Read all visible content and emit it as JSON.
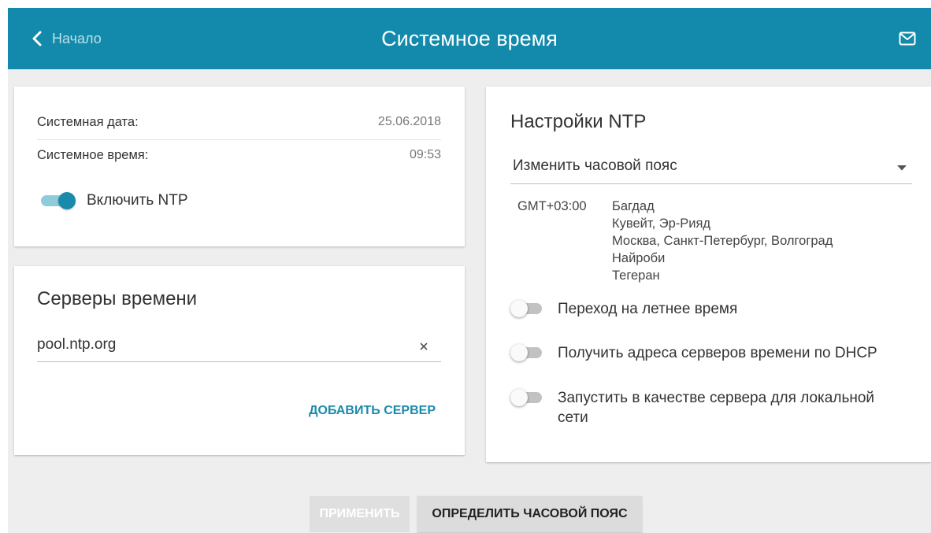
{
  "colors": {
    "header_background": "#138aab",
    "accent": "#1a8aab",
    "toggle_track_on": "#8fcbdb",
    "toggle_track_off": "#c2c2c2",
    "page_background": "#eeeeee"
  },
  "header": {
    "back_icon": "chevron-left-icon",
    "back_label": "Начало",
    "title": "Системное время",
    "mail_icon": "envelope-icon"
  },
  "system_info": {
    "date_label": "Системная дата:",
    "date_value": "25.06.2018",
    "time_label": "Системное время:",
    "time_value": "09:53",
    "ntp_toggle": {
      "label": "Включить NTP",
      "checked": true
    }
  },
  "time_servers": {
    "title": "Серверы времени",
    "servers": [
      {
        "address": "pool.ntp.org",
        "clear_icon": "close-icon"
      }
    ],
    "add_button": "ДОБАВИТЬ СЕРВЕР"
  },
  "ntp_settings": {
    "title": "Настройки NTP",
    "timezone_select": {
      "selected": "Изменить часовой пояс",
      "arrow_icon": "caret-down-icon"
    },
    "timezone": {
      "offset": "GMT+03:00",
      "cities": [
        "Багдад",
        "Кувейт, Эр-Рияд",
        "Москва, Санкт-Петербург, Волгоград",
        "Найроби",
        "Тегеран"
      ]
    },
    "toggles": [
      {
        "label": "Переход на летнее время",
        "checked": false
      },
      {
        "label": "Получить адреса серверов времени по DHCP",
        "checked": false
      },
      {
        "label": "Запустить в качестве сервера для локальной сети",
        "checked": false
      }
    ]
  },
  "actions": {
    "apply": {
      "label": "ПРИМЕНИТЬ",
      "disabled": true
    },
    "detect_timezone": {
      "label": "ОПРЕДЕЛИТЬ ЧАСОВОЙ ПОЯС",
      "disabled": false
    }
  }
}
